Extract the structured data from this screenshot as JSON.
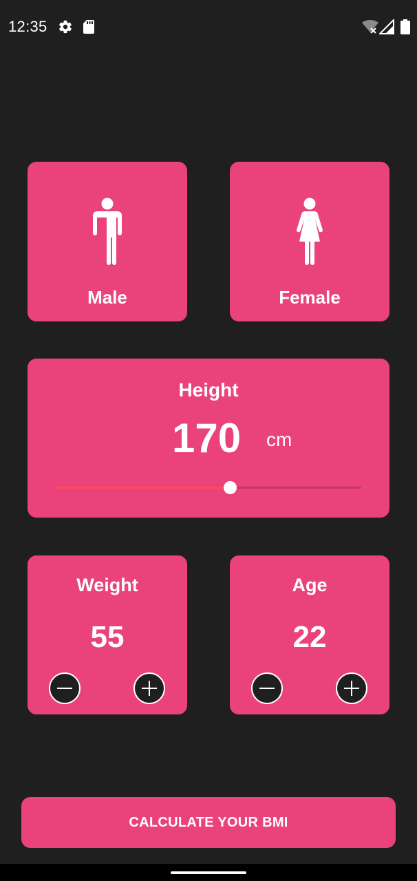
{
  "status_bar": {
    "time": "12:35",
    "icons": [
      "gear-icon",
      "sd-card-icon",
      "wifi-off-icon",
      "signal-icon",
      "battery-icon"
    ]
  },
  "colors": {
    "background": "#1f1f1f",
    "card": "#ea437c",
    "slider_active": "#ff4a58",
    "slider_inactive": "#c2376a"
  },
  "gender": {
    "male": {
      "label": "Male",
      "icon": "male-icon"
    },
    "female": {
      "label": "Female",
      "icon": "female-icon"
    }
  },
  "height": {
    "title": "Height",
    "value": "170",
    "unit": "cm",
    "slider_fraction": 0.57
  },
  "weight": {
    "title": "Weight",
    "value": "55",
    "minus_icon": "minus-icon",
    "plus_icon": "plus-icon"
  },
  "age": {
    "title": "Age",
    "value": "22",
    "minus_icon": "minus-icon",
    "plus_icon": "plus-icon"
  },
  "calculate_button": {
    "label": "CALCULATE YOUR BMI"
  }
}
